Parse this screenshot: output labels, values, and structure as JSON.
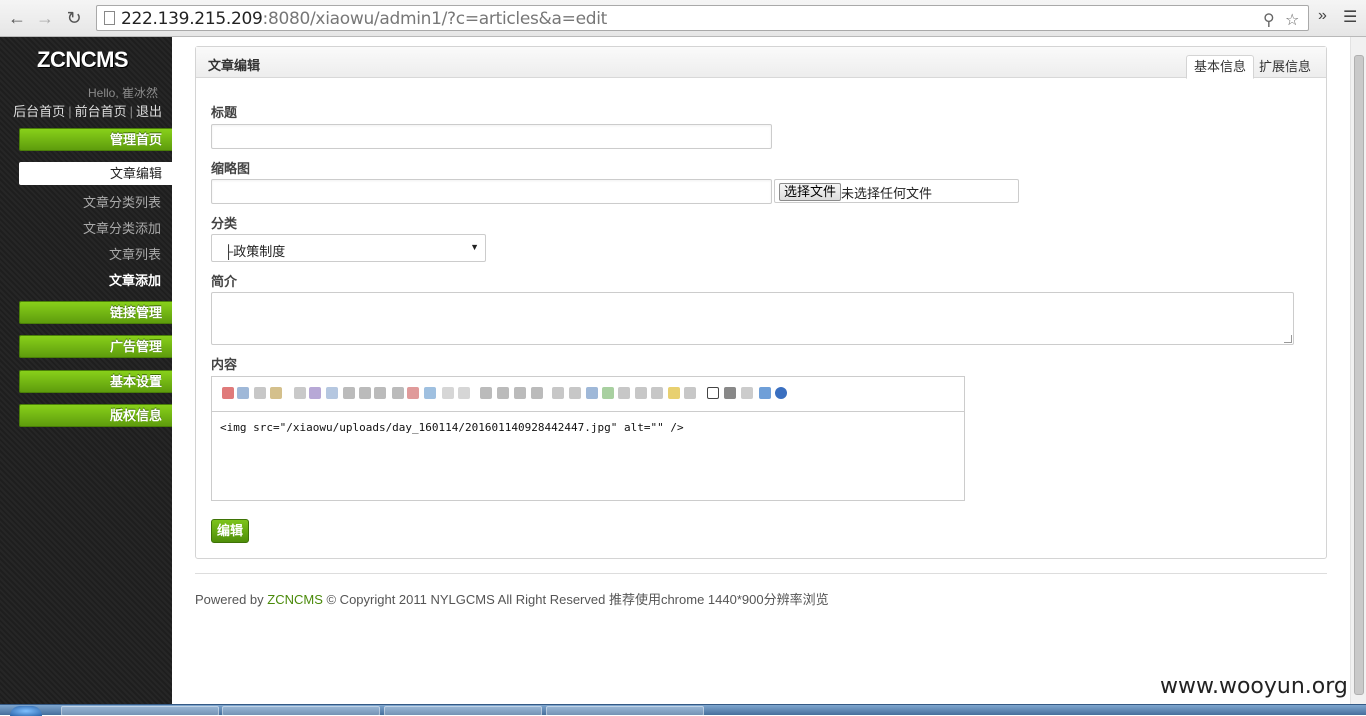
{
  "browser": {
    "url_host": "222.139.215.209",
    "url_rest": ":8080/xiaowu/admin1/?c=articles&a=edit"
  },
  "sidebar": {
    "logo": "ZCNCMS",
    "hello": "Hello, 崔冰然",
    "links": [
      "后台首页",
      "前台首页",
      "退出"
    ],
    "menu": {
      "home": "管理首页",
      "links": "链接管理",
      "ads": "广告管理",
      "settings": "基本设置",
      "copyright": "版权信息"
    },
    "sub": {
      "active": "文章编辑",
      "cat_list": "文章分类列表",
      "cat_add": "文章分类添加",
      "article_list": "文章列表",
      "article_add": "文章添加"
    }
  },
  "panel": {
    "title": "文章编辑",
    "tabs": [
      "基本信息",
      "扩展信息"
    ],
    "labels": {
      "title": "标题",
      "thumb": "缩略图",
      "category": "分类",
      "summary": "简介",
      "content": "内容"
    },
    "title_value": "",
    "thumb_value": "",
    "file_button": "选择文件",
    "file_status": "未选择任何文件",
    "category_value": "├政策制度",
    "summary_value": "",
    "content_value": "<img src=\"/xiaowu/uploads/day_160114/201601140928442447.jpg\" alt=\"\" />",
    "submit": "编辑"
  },
  "footer": {
    "prefix": "Powered by ",
    "brand": "ZCNCMS",
    "suffix": " © Copyright 2011 NYLGCMS All Right Reserved 推荐使用chrome 1440*900分辨率浏览"
  },
  "watermark": "www.wooyun.org",
  "colors": {
    "menu_green": "#6cb014",
    "sidebar_bg": "#222222",
    "brand_green": "#4a8a0a"
  }
}
